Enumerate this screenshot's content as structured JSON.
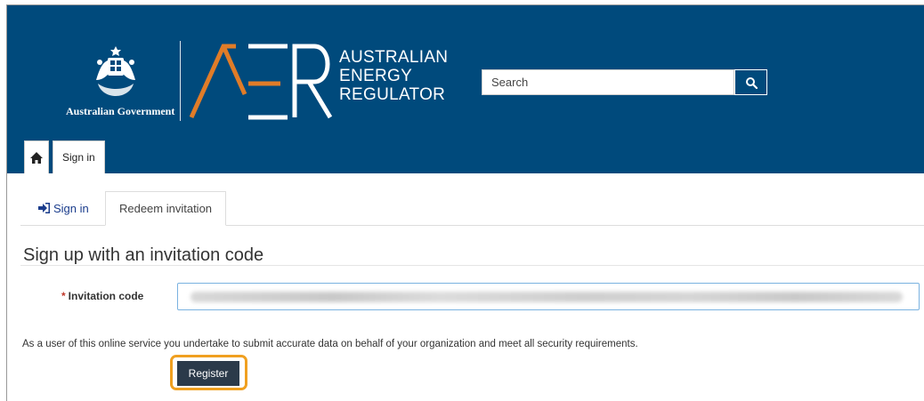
{
  "header": {
    "government_text": "Australian Government",
    "regulator_name": [
      "AUSTRALIAN",
      "ENERGY",
      "REGULATOR"
    ],
    "logo_letters": "AER",
    "search_placeholder": "Search",
    "search_icon": "search-icon",
    "brand_color": "#004a7c",
    "accent_color": "#e07c28"
  },
  "nav": {
    "home_icon": "home-icon",
    "signin_tab": "Sign in"
  },
  "subtabs": {
    "signin_label": "Sign in",
    "signin_icon": "sign-in-icon",
    "redeem_label": "Redeem invitation"
  },
  "form": {
    "title": "Sign up with an invitation code",
    "invitation_label": "Invitation code",
    "required_marker": "*",
    "disclaimer": "As a user of this online service you undertake to submit accurate data on behalf of your organization and meet all security requirements.",
    "register_label": "Register",
    "highlight_color": "#f0a020"
  }
}
